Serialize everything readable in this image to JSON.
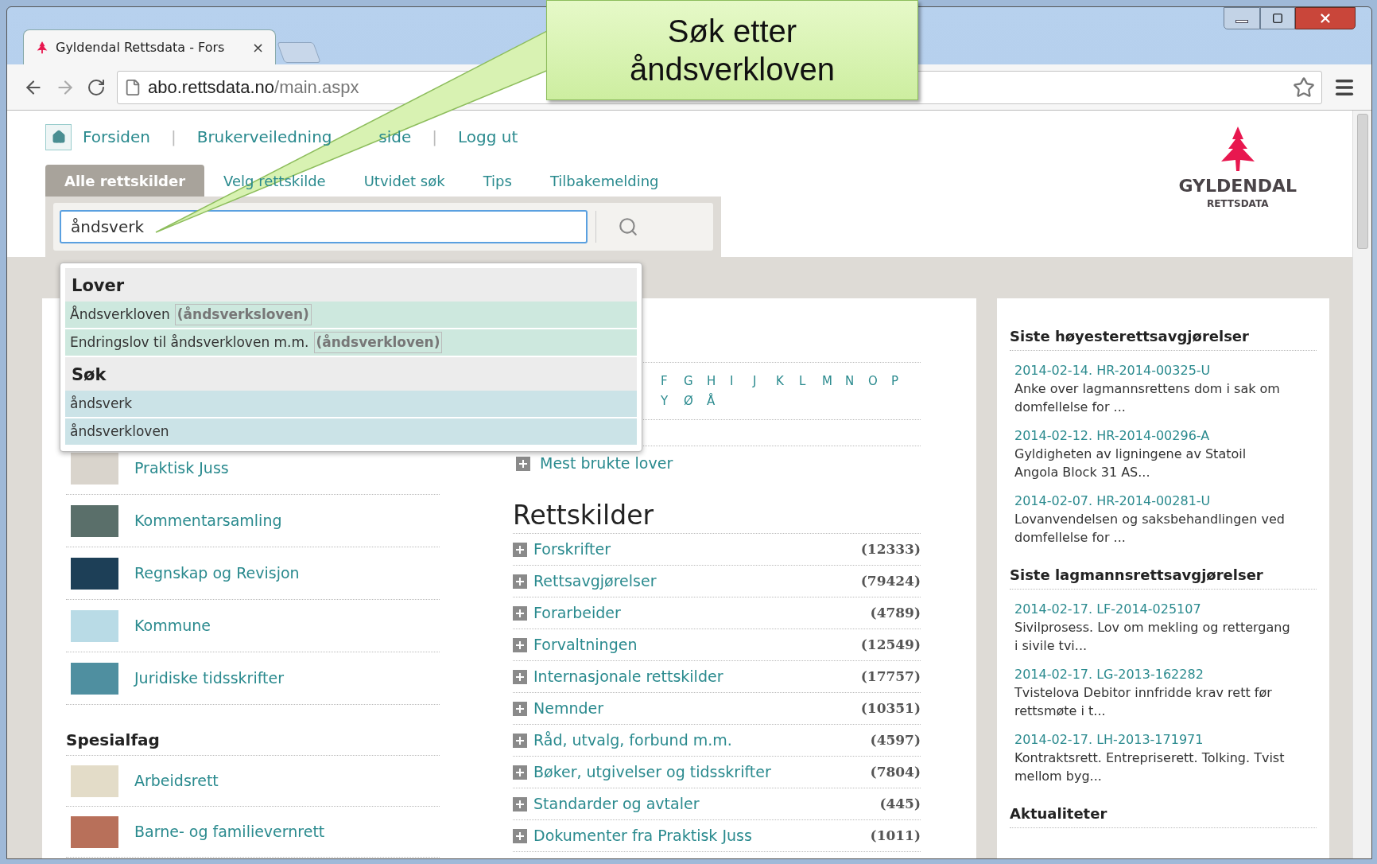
{
  "browser": {
    "tabs": [
      {
        "title": "Gyldendal Rettsdata - Fors",
        "close": "×",
        "selected": true
      }
    ],
    "url_host": "abo.rettsdata.no",
    "url_path": "/main.aspx"
  },
  "callout": {
    "lines": [
      "Søk etter",
      "åndsverkloven"
    ]
  },
  "top_nav": {
    "separator": "|",
    "items": [
      "Forsiden",
      "Brukerveiledning",
      "side",
      "Logg ut"
    ]
  },
  "logo": {
    "name": "GYLDENDAL",
    "sub": "RETTSDATA"
  },
  "search_tabs": [
    {
      "label": "Alle rettskilder",
      "selected": true
    },
    {
      "label": "Velg rettskilde",
      "selected": false
    },
    {
      "label": "Utvidet søk",
      "selected": false
    },
    {
      "label": "Tips",
      "selected": false
    },
    {
      "label": "Tilbakemelding",
      "selected": false
    }
  ],
  "search": {
    "value": "åndsverk"
  },
  "suggestions": [
    {
      "heading": "Lover",
      "kind": "law",
      "items": [
        {
          "text": "Åndsverkloven",
          "tag": "(åndsverksloven)"
        },
        {
          "text": "Endringslov til åndsverkloven m.m.",
          "tag": "(åndsverkloven)"
        }
      ]
    },
    {
      "heading": "Søk",
      "kind": "query",
      "items": [
        {
          "text": "åndsverk"
        },
        {
          "text": "åndsverkloven"
        }
      ]
    }
  ],
  "left": {
    "items": [
      {
        "label": "Praktisk Juss",
        "color": "#d9d4cc"
      },
      {
        "label": "Kommentarsamling",
        "color": "#5a6f6a"
      },
      {
        "label": "Regnskap og Revisjon",
        "color": "#1d3f57"
      },
      {
        "label": "Kommune",
        "color": "#b9dbe6"
      },
      {
        "label": "Juridiske tidsskrifter",
        "color": "#4f8fa0"
      }
    ],
    "special_heading": "Spesialfag",
    "special_items": [
      {
        "label": "Arbeidsrett",
        "color": "#e3dcc8"
      },
      {
        "label": "Barne- og familievernrett",
        "color": "#b8705a"
      }
    ]
  },
  "middle": {
    "letters_row1": [
      "F",
      "G",
      "H",
      "I",
      "J",
      "K",
      "L",
      "M",
      "N",
      "O",
      "P"
    ],
    "letters_row2": [
      "Y",
      "Ø",
      "Å"
    ],
    "most_used": "Mest brukte lover",
    "heading": "Rettskilder",
    "sources": [
      {
        "label": "Forskrifter",
        "count": "(12333)"
      },
      {
        "label": "Rettsavgjørelser",
        "count": "(79424)"
      },
      {
        "label": "Forarbeider",
        "count": "(4789)"
      },
      {
        "label": "Forvaltningen",
        "count": "(12549)"
      },
      {
        "label": "Internasjonale rettskilder",
        "count": "(17757)"
      },
      {
        "label": "Nemnder",
        "count": "(10351)"
      },
      {
        "label": "Råd, utvalg, forbund m.m.",
        "count": "(4597)"
      },
      {
        "label": "Bøker, utgivelser og tidsskrifter",
        "count": "(7804)"
      },
      {
        "label": "Standarder og avtaler",
        "count": "(445)"
      },
      {
        "label": "Dokumenter fra Praktisk Juss",
        "count": "(1011)"
      }
    ]
  },
  "right": {
    "sections": [
      {
        "heading": "Siste høyesterettsavgjørelser",
        "items": [
          {
            "ref": "2014-02-14. HR-2014-00325-U",
            "text": "Anke over lagmannsrettens dom i sak om domfellelse for ..."
          },
          {
            "ref": "2014-02-12. HR-2014-00296-A",
            "text": "Gyldigheten av ligningene av Statoil Angola Block 31 AS..."
          },
          {
            "ref": "2014-02-07. HR-2014-00281-U",
            "text": "Lovanvendelsen og saksbehandlingen ved domfellelse for ..."
          }
        ]
      },
      {
        "heading": "Siste lagmannsrettsavgjørelser",
        "items": [
          {
            "ref": "2014-02-17. LF-2014-025107",
            "text": "Sivilprosess. Lov om mekling og rettergang i sivile tvi..."
          },
          {
            "ref": "2014-02-17. LG-2013-162282",
            "text": "Tvistelova Debitor innfridde krav rett før rettsmøte i t..."
          },
          {
            "ref": "2014-02-17. LH-2013-171971",
            "text": "Kontraktsrett. Entrepriserett. Tolking. Tvist mellom byg..."
          }
        ]
      },
      {
        "heading": "Aktualiteter"
      }
    ]
  }
}
